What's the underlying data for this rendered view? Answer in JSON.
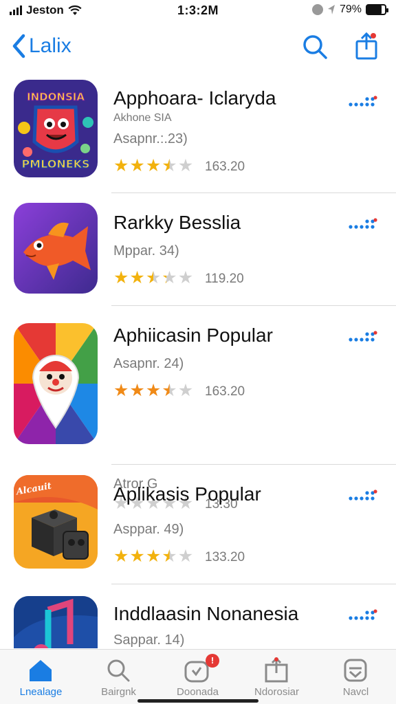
{
  "status_bar": {
    "carrier": "Jeston",
    "time": "1:3:2M",
    "battery": "79%",
    "battery_level": 0.79
  },
  "nav": {
    "back_label": "Lalix",
    "search_icon": "search-icon",
    "share_icon": "share-icon"
  },
  "apps": [
    {
      "name": "Apphoara- Iclaryda",
      "subtitle": "Akhone SIA",
      "meta": "Asapnr.:.23)",
      "rating_count": "163.20",
      "stars": [
        1,
        1,
        1,
        0.5,
        0
      ],
      "icon_text_top": "INDONSIA",
      "icon_text_bottom": "PMLONEKS",
      "icon": "game-icon"
    },
    {
      "name": "Rarkky Besslia",
      "meta": "Mppar. 34)",
      "rating_count": "119.20",
      "stars": [
        1,
        1,
        0.5,
        0.3,
        0
      ],
      "icon": "fish-icon"
    },
    {
      "name": "Aphiicasin Popular",
      "meta": "Asapnr. 24)",
      "rating_count": "163.20",
      "stars": [
        1,
        1,
        1,
        0.5,
        0
      ],
      "star_color": "#f08a17",
      "extra_meta": "Atror G",
      "extra_rating_count": "13:30",
      "extra_stars": [
        0,
        0,
        0,
        0,
        0
      ],
      "icon": "clown-pin-icon"
    },
    {
      "name": "Aplikasis Popular",
      "meta": "Asppar. 49)",
      "rating_count": "133.20",
      "stars": [
        1,
        1,
        1,
        0.5,
        0
      ],
      "icon_text_top": "Alcauit",
      "icon": "box-game-icon"
    },
    {
      "name": "Inddlaasin Nonanesia",
      "meta": "Sappar. 14)",
      "icon": "music-icon"
    }
  ],
  "more_icon": "more-dots-icon",
  "tabs": [
    {
      "label": "Lnealage",
      "icon": "home-icon",
      "active": true
    },
    {
      "label": "Bairgnk",
      "icon": "search-icon",
      "active": false
    },
    {
      "label": "Doonada",
      "icon": "apps-icon",
      "active": false,
      "badge": "!"
    },
    {
      "label": "Ndorosiar",
      "icon": "updates-icon",
      "active": false
    },
    {
      "label": "Navcl",
      "icon": "profile-icon",
      "active": false
    }
  ],
  "colors": {
    "accent": "#1a7de3",
    "star": "#f2b20e",
    "star_orange": "#f08a17",
    "badge": "#e53935"
  }
}
